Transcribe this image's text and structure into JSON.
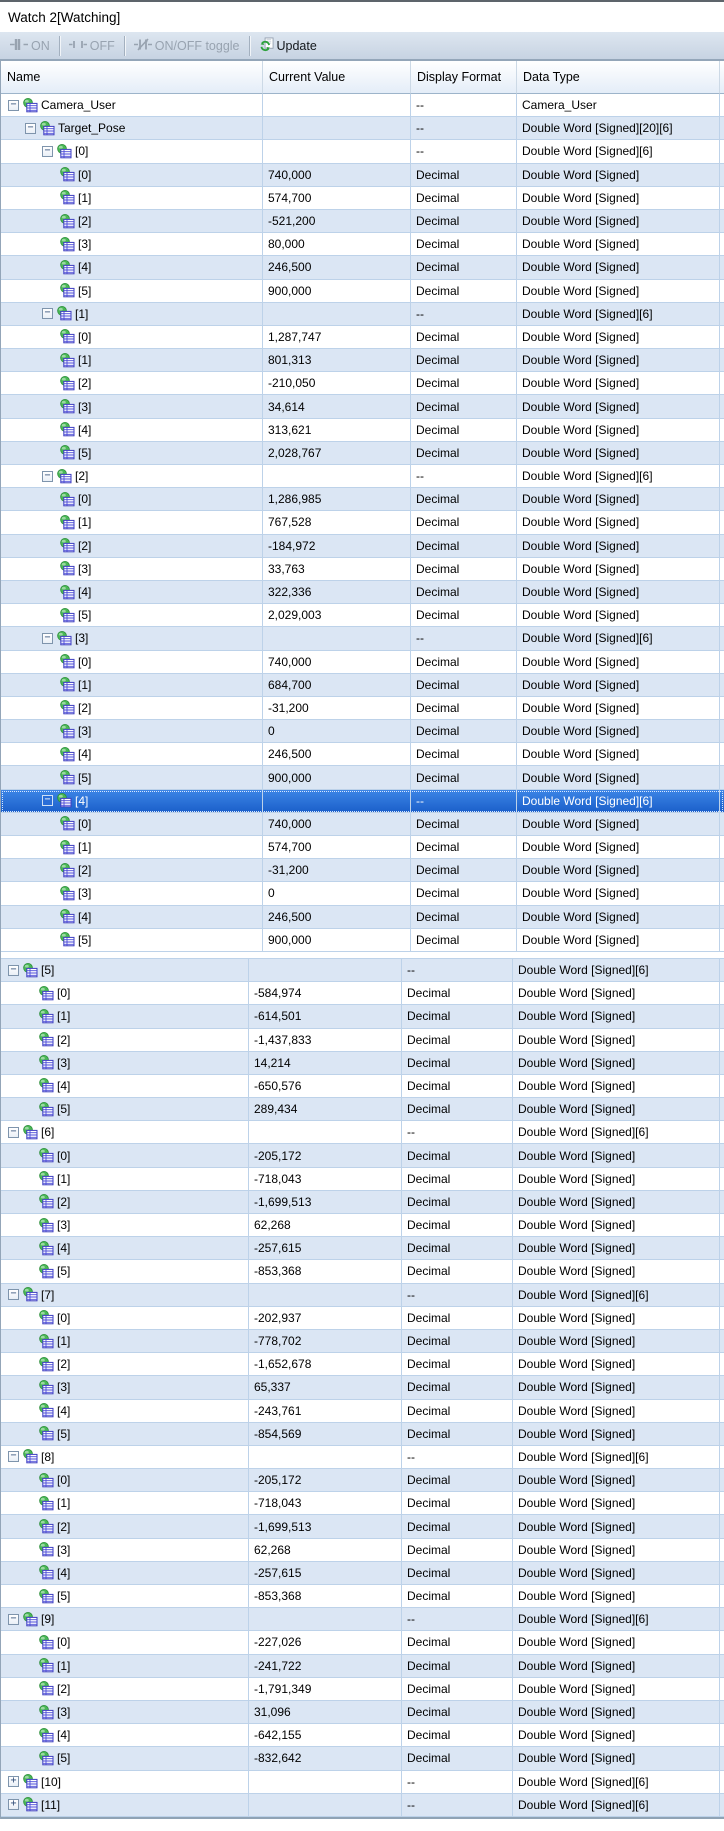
{
  "window_title": "Watch 2[Watching]",
  "toolbar": {
    "on_label": "ON",
    "off_label": "OFF",
    "toggle_label": "ON/OFF toggle",
    "update_label": "Update"
  },
  "columns": {
    "name": "Name",
    "value": "Current Value",
    "format": "Display Format",
    "type": "Data Type"
  },
  "colors": {
    "selection_blue": "#1a5ec9",
    "row_alt_blue": "#dbe6f4",
    "grid_line": "#bdd2e9",
    "update_icon_green": "#2ba03a",
    "disabled_text": "#98a3b0"
  },
  "tree": {
    "root": {
      "label": "Camera_User",
      "value": "",
      "format": "--",
      "type": "Camera_User"
    },
    "array": {
      "label": "Target_Pose",
      "value": "",
      "format": "--",
      "type": "Double Word [Signed][20][6]"
    },
    "group_format": "--",
    "group_type": "Double Word [Signed][6]",
    "leaf_format": "Decimal",
    "leaf_type": "Double Word [Signed]",
    "leaf_labels": [
      "[0]",
      "[1]",
      "[2]",
      "[3]",
      "[4]",
      "[5]"
    ],
    "groups": [
      {
        "label": "[0]",
        "section": "top",
        "values": [
          "740,000",
          "574,700",
          "-521,200",
          "80,000",
          "246,500",
          "900,000"
        ]
      },
      {
        "label": "[1]",
        "section": "top",
        "values": [
          "1,287,747",
          "801,313",
          "-210,050",
          "34,614",
          "313,621",
          "2,028,767"
        ]
      },
      {
        "label": "[2]",
        "section": "top",
        "values": [
          "1,286,985",
          "767,528",
          "-184,972",
          "33,763",
          "322,336",
          "2,029,003"
        ]
      },
      {
        "label": "[3]",
        "section": "top",
        "values": [
          "740,000",
          "684,700",
          "-31,200",
          "0",
          "246,500",
          "900,000"
        ]
      },
      {
        "label": "[4]",
        "section": "top",
        "selected": true,
        "values": [
          "740,000",
          "574,700",
          "-31,200",
          "0",
          "246,500",
          "900,000"
        ]
      },
      {
        "label": "[5]",
        "section": "bottom",
        "values": [
          "-584,974",
          "-614,501",
          "-1,437,833",
          "14,214",
          "-650,576",
          "289,434"
        ]
      },
      {
        "label": "[6]",
        "section": "bottom",
        "values": [
          "-205,172",
          "-718,043",
          "-1,699,513",
          "62,268",
          "-257,615",
          "-853,368"
        ]
      },
      {
        "label": "[7]",
        "section": "bottom",
        "values": [
          "-202,937",
          "-778,702",
          "-1,652,678",
          "65,337",
          "-243,761",
          "-854,569"
        ]
      },
      {
        "label": "[8]",
        "section": "bottom",
        "values": [
          "-205,172",
          "-718,043",
          "-1,699,513",
          "62,268",
          "-257,615",
          "-853,368"
        ]
      },
      {
        "label": "[9]",
        "section": "bottom",
        "values": [
          "-227,026",
          "-241,722",
          "-1,791,349",
          "31,096",
          "-642,155",
          "-832,642"
        ]
      },
      {
        "label": "[10]",
        "section": "bottom",
        "collapsed": true
      },
      {
        "label": "[11]",
        "section": "bottom",
        "collapsed": true
      }
    ]
  }
}
